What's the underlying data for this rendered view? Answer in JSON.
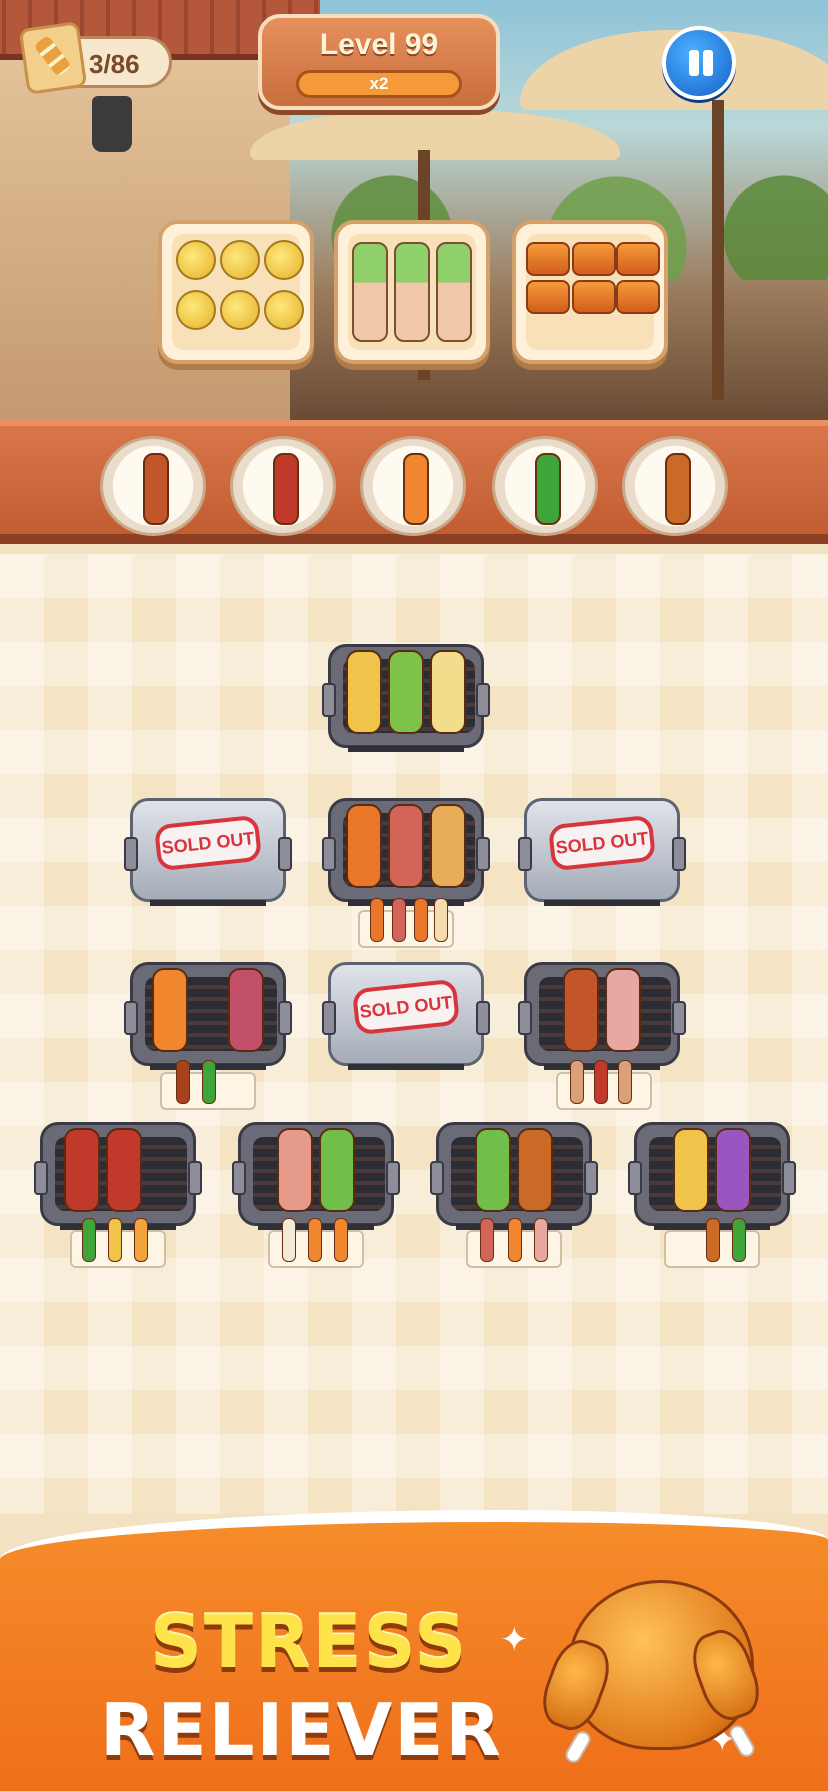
{
  "hud": {
    "counter": "3/86",
    "level": "Level 99",
    "multiplier": "x2"
  },
  "orders": [
    {
      "name": "corn-skewers-order"
    },
    {
      "name": "asparagus-rolls-order"
    },
    {
      "name": "chicken-skewers-order"
    }
  ],
  "shelf": [
    {
      "name": "meatball-skewer-plate",
      "color": "#c2552a"
    },
    {
      "name": "bacon-strip-plate",
      "color": "#c0392b"
    },
    {
      "name": "shrimp-skewer-plate",
      "color": "#f0862e"
    },
    {
      "name": "green-pepper-skewer-plate",
      "color": "#3fa43a"
    },
    {
      "name": "chicken-leg-plate",
      "color": "#c96a26"
    }
  ],
  "sold_out_label": "SOLD OUT",
  "banner": {
    "line1": "STRESS",
    "line2": "RELIEVER"
  }
}
